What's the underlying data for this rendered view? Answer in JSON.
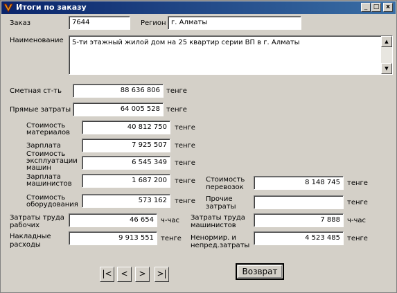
{
  "window": {
    "title": "Итоги по заказу",
    "controls": [
      "minimize-icon",
      "maximize-icon",
      "close-icon"
    ]
  },
  "order": {
    "label": "Заказ",
    "value": "7644"
  },
  "region": {
    "label": "Регион",
    "value": "г. Алматы"
  },
  "name": {
    "label": "Наименование",
    "value": "5-ти этажный жилой дом на 25 квартир серии ВП в г. Алматы"
  },
  "estimate": {
    "label": "Сметная ст-ть",
    "value": "88 636 806",
    "unit": "тенге"
  },
  "direct": {
    "label": "Прямые затраты",
    "value": "64 005 528",
    "unit": "тенге"
  },
  "materials": {
    "label1": "Стоимость",
    "label2": "материалов",
    "value": "40 812 750",
    "unit": "тенге"
  },
  "salary": {
    "label": "Зарплата",
    "value": "7 925 507",
    "unit": "тенге"
  },
  "machines": {
    "label1": "Стоимость",
    "label2": "эксплуатации",
    "label3": "машин",
    "value": "6 545 349",
    "unit": "тенге"
  },
  "operators_salary": {
    "label1": "Зарплата",
    "label2": "машинистов",
    "value": "1 687 200",
    "unit": "тенге"
  },
  "equipment": {
    "label1": "Стоимость",
    "label2": "оборудования",
    "value": "573 162",
    "unit": "тенге"
  },
  "transport": {
    "label1": "Стоимость",
    "label2": "перевозок",
    "value": "8 148 745",
    "unit": "тенге"
  },
  "other": {
    "label1": "Прочие",
    "label2": "затраты",
    "value": "",
    "unit": "тенге"
  },
  "labor_workers": {
    "label1": "Затраты  труда",
    "label2": "рабочих",
    "value": "46 654",
    "unit": "ч-час"
  },
  "labor_operators": {
    "label1": "Затраты  труда",
    "label2": "машинистов",
    "value": "7 888",
    "unit": "ч-час"
  },
  "overhead": {
    "label1": "Накладные",
    "label2": "расходы",
    "value": "9 913 551",
    "unit": "тенге"
  },
  "unregulated": {
    "label1": "Ненормир. и",
    "label2": "непред.затраты",
    "value": "4 523 485",
    "unit": "тенге"
  },
  "nav": {
    "first": "|<",
    "prev": "<",
    "next": ">",
    "last": ">|"
  },
  "back_button": "Возврат"
}
